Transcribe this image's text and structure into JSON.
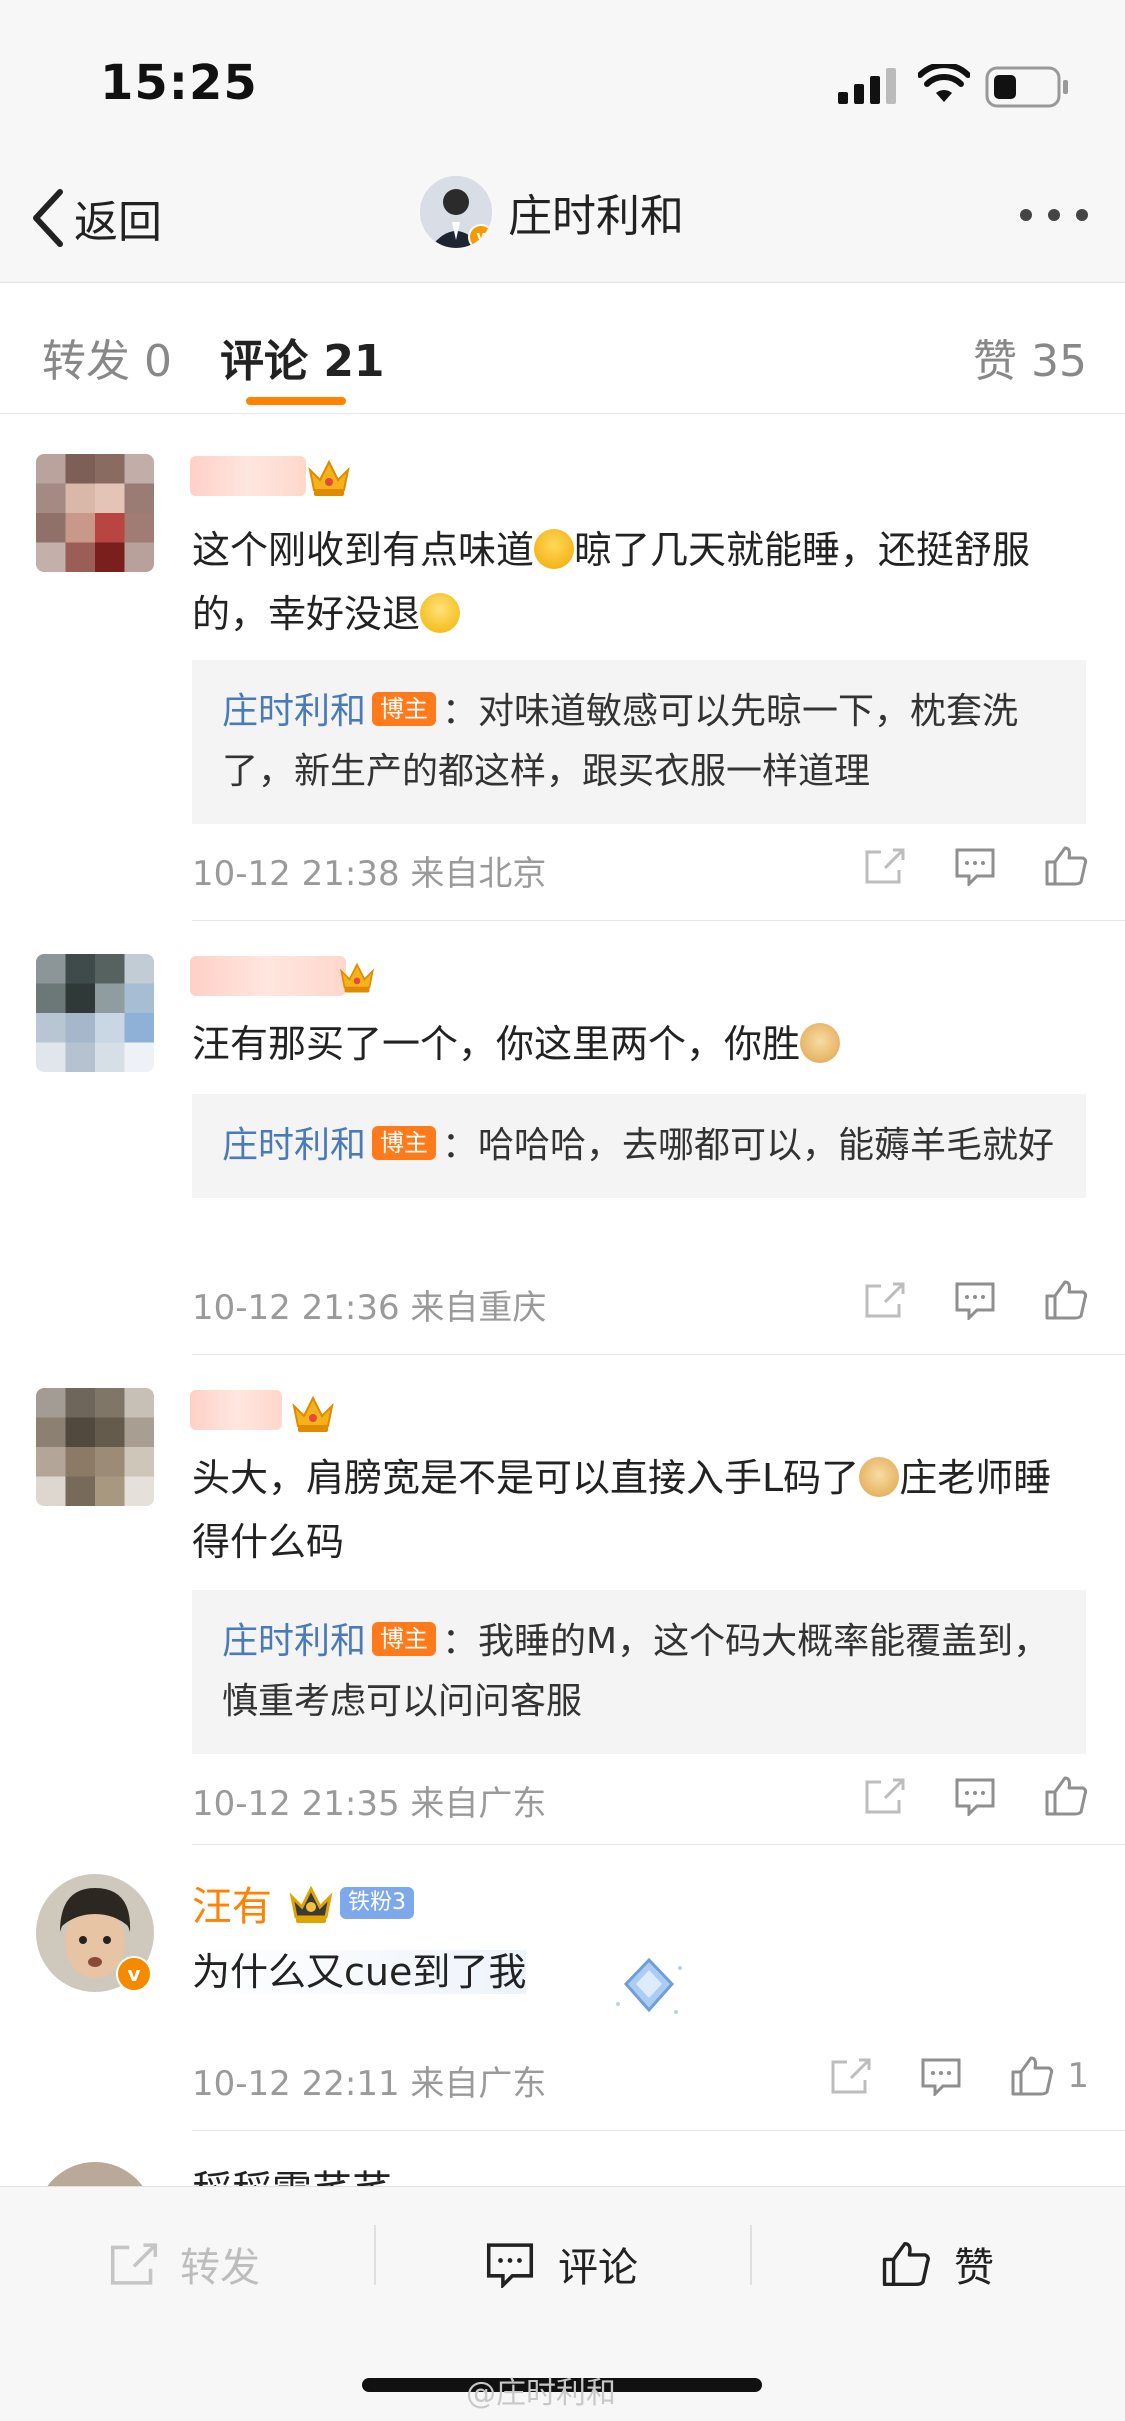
{
  "status_bar": {
    "time": "15:25"
  },
  "nav": {
    "back_label": "返回",
    "title": "庄时利和"
  },
  "tabs": {
    "repost": "转发 0",
    "comments": "评论 21",
    "likes": "赞 35"
  },
  "comments": [
    {
      "text": "这个刚收到有点味道",
      "text_after_emoji": "晾了几天就能睡，还挺舒服的，幸好没退",
      "reply_name": "庄时利和",
      "owner_badge": "博主",
      "reply_text": "：对味道敏感可以先晾一下，枕套洗了，新生产的都这样，跟买衣服一样道理",
      "meta": "10-12 21:38  来自北京"
    },
    {
      "text": "汪有那买了一个，你这里两个，你胜",
      "reply_name": "庄时利和",
      "owner_badge": "博主",
      "reply_text": "：哈哈哈，去哪都可以，能薅羊毛就好",
      "meta": "10-12 21:36  来自重庆"
    },
    {
      "text": "头大，肩膀宽是不是可以直接入手L码了",
      "text_after_emoji": "庄老师睡得什么码",
      "reply_name": "庄时利和",
      "owner_badge": "博主",
      "reply_text": "：我睡的M，这个码大概率能覆盖到，慎重考虑可以问问客服",
      "meta": "10-12 21:35  来自广东"
    },
    {
      "name": "汪有",
      "fan_badge": "铁粉3",
      "text": "为什么又cue到了我",
      "meta": "10-12 22:11  来自广东",
      "like_count": "1"
    }
  ],
  "partial_next": {
    "name": "稻稻需芊芊"
  },
  "bottom_bar": {
    "repost": "转发",
    "comment": "评论",
    "like": "赞"
  },
  "watermark": "@庄时利和",
  "colors": {
    "accent": "#ff8200",
    "link": "#4a7ab8",
    "owner_badge": "#ff7a1a"
  }
}
